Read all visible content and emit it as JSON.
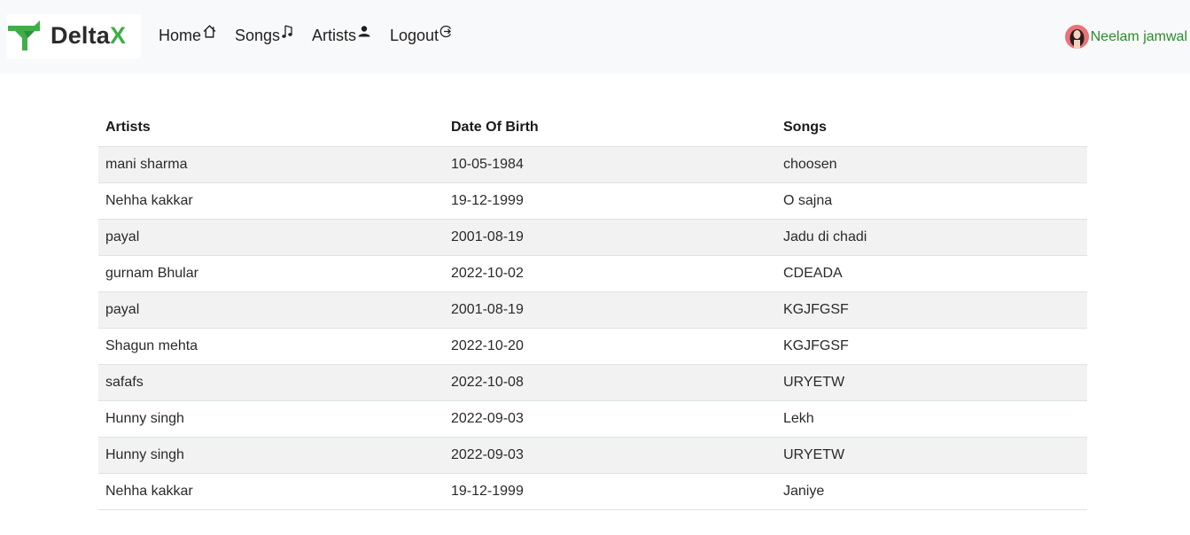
{
  "brand": {
    "name_main": "Delta",
    "name_accent": "X"
  },
  "nav": {
    "home": "Home",
    "songs": "Songs",
    "artists": "Artists",
    "logout": "Logout"
  },
  "user": {
    "name": "Neelam jamwal"
  },
  "colors": {
    "accent_green": "#3fae49",
    "username": "#2e8b2e",
    "navbar_bg": "#f8f9fa",
    "stripe": "#f2f2f2"
  },
  "icons": {
    "home": "home-icon",
    "songs": "music-note-icon",
    "artists": "person-icon",
    "logout": "logout-icon",
    "logo": "deltax-logo-icon"
  },
  "table": {
    "headers": [
      "Artists",
      "Date Of Birth",
      "Songs"
    ],
    "rows": [
      [
        "mani sharma",
        "10-05-1984",
        "choosen"
      ],
      [
        "Nehha kakkar",
        "19-12-1999",
        "O sajna"
      ],
      [
        "payal",
        "2001-08-19",
        "Jadu di chadi"
      ],
      [
        "gurnam Bhular",
        "2022-10-02",
        "CDEADA"
      ],
      [
        "payal",
        "2001-08-19",
        "KGJFGSF"
      ],
      [
        "Shagun mehta",
        "2022-10-20",
        "KGJFGSF"
      ],
      [
        "safafs",
        "2022-10-08",
        "URYETW"
      ],
      [
        "Hunny singh",
        "2022-09-03",
        "Lekh"
      ],
      [
        "Hunny singh",
        "2022-09-03",
        "URYETW"
      ],
      [
        "Nehha kakkar",
        "19-12-1999",
        "Janiye"
      ]
    ]
  }
}
